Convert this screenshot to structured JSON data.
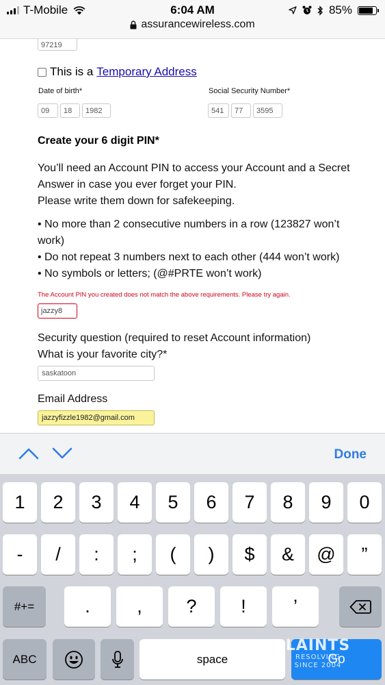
{
  "status_bar": {
    "carrier": "T-Mobile",
    "time": "6:04 AM",
    "battery": "85%",
    "battery_level": 0.85,
    "url": "assurancewireless.com"
  },
  "form": {
    "zip_value": "97219",
    "temporary_prefix": "This is a",
    "temporary_link": "Temporary Address",
    "dob_label": "Date of birth*",
    "dob_month": "09",
    "dob_day": "18",
    "dob_year": "1982",
    "ssn_label": "Social Security Number*",
    "ssn_1": "541",
    "ssn_2": "77",
    "ssn_3": "3595",
    "pin_heading": "Create your 6 digit PIN*",
    "pin_intro_1": "You’ll need an Account PIN to access your Account and a Secret Answer in case you ever forget your PIN.",
    "pin_intro_2": "Please write them down for safekeeping.",
    "rules": [
      "• No more than 2 consecutive numbers in a row (123827 won’t work)",
      "• Do not repeat 3 numbers next to each other (444 won’t work)",
      "• No symbols or letters; (@#PRTE won’t work)"
    ],
    "pin_error": "The Account PIN you created does not match the above requirements. Please try again.",
    "pin_value": "jazzy8",
    "security_label": "Security question (required to reset Account information)",
    "security_question": "What is your favorite city?*",
    "security_answer": "saskatoon",
    "email_label": "Email Address",
    "email_value": "jazzyfizzle1982@gmail.com"
  },
  "accessory": {
    "done_label": "Done"
  },
  "keyboard": {
    "row1": [
      "1",
      "2",
      "3",
      "4",
      "5",
      "6",
      "7",
      "8",
      "9",
      "0"
    ],
    "row2": [
      "-",
      "/",
      ":",
      ";",
      "(",
      ")",
      "$",
      "&",
      "@",
      "”"
    ],
    "row3_mode": "#+=",
    "row3": [
      ".",
      ",",
      "?",
      "!",
      "’"
    ],
    "abc_label": "ABC",
    "space_label": "space",
    "go_label": "Go"
  },
  "watermark": {
    "line1": "LAINTS",
    "line2": "RESOLVING",
    "line3": "SINCE 2004"
  }
}
